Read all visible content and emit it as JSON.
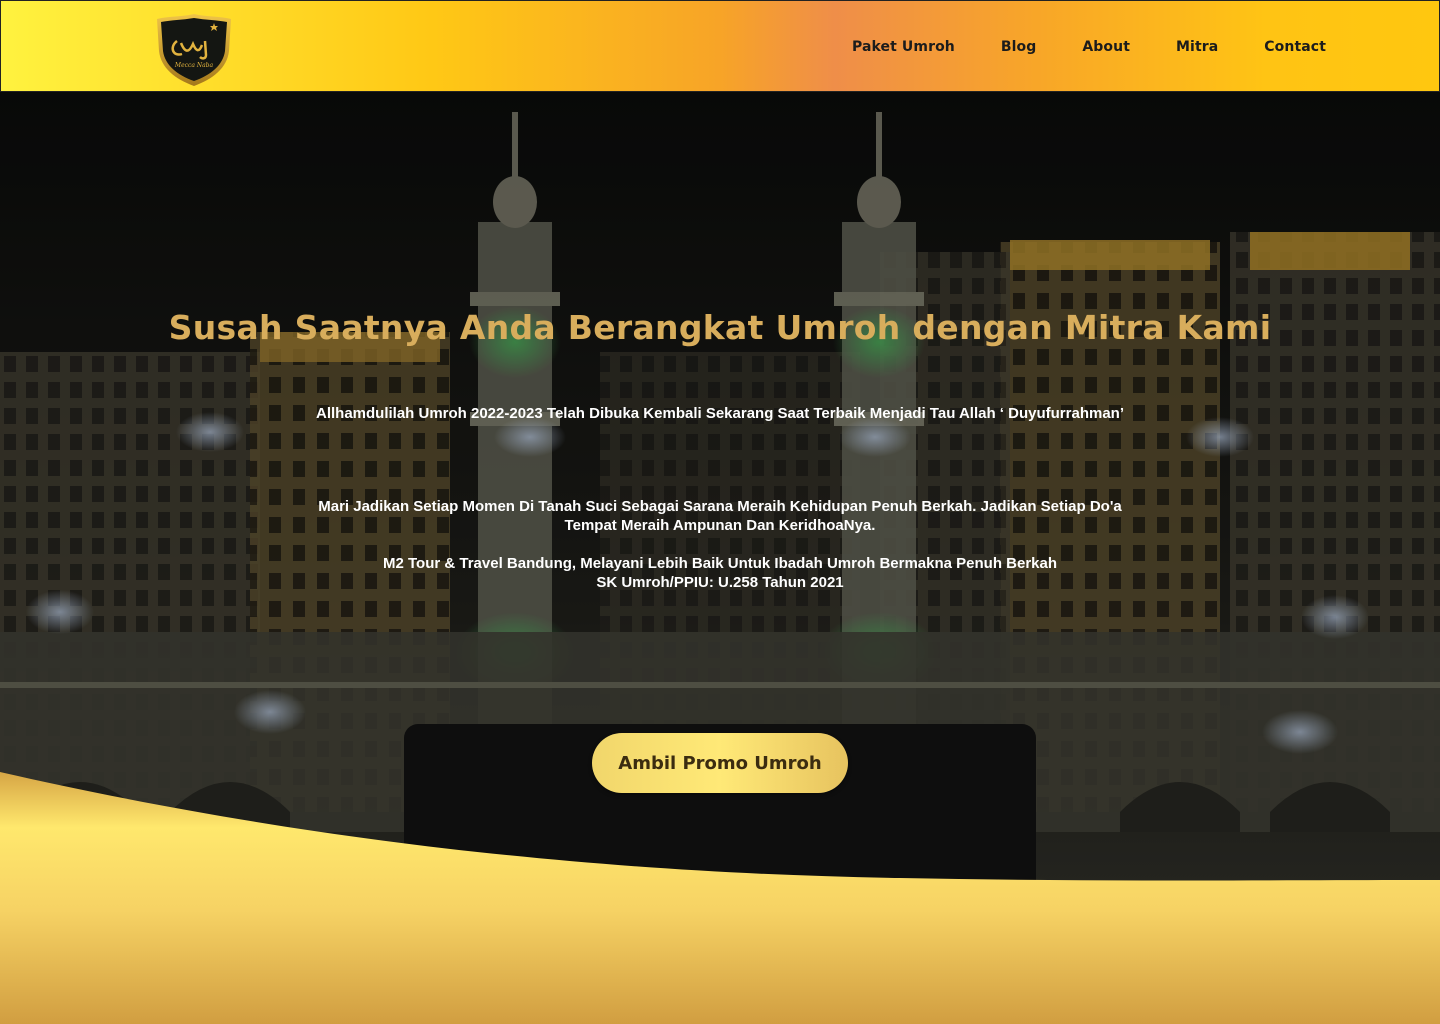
{
  "brand": {
    "logo_icon": "crest-logo-icon",
    "logo_text": "Mecca Naba"
  },
  "nav": {
    "items": [
      "Paket Umroh",
      "Blog",
      "About",
      "Mitra",
      "Contact"
    ]
  },
  "hero": {
    "headline": "Susah Saatnya Anda Berangkat Umroh dengan Mitra Kami",
    "line1": "Allhamdulilah Umroh 2022-2023 Telah Dibuka Kembali Sekarang Saat  Terbaik Menjadi Tau Allah ‘ Duyufurrahman’",
    "line2a": "Mari Jadikan Setiap Momen Di Tanah Suci Sebagai Sarana Meraih Kehidupan Penuh Berkah. Jadikan Setiap Do'a",
    "line2b": "Tempat Meraih Ampunan Dan KeridhoaNya.",
    "line3a": "M2 Tour & Travel Bandung, Melayani Lebih Baik Untuk Ibadah Umroh Bermakna Penuh Berkah",
    "line3b": "SK Umroh/PPIU: U.258 Tahun 2021",
    "cta_label": "Ambil Promo Umroh"
  },
  "colors": {
    "headline": "#d8ad5c",
    "nav_gradient_start": "#fff23f",
    "nav_gradient_mid": "#ef8e49",
    "wave": "#ffe56b"
  }
}
